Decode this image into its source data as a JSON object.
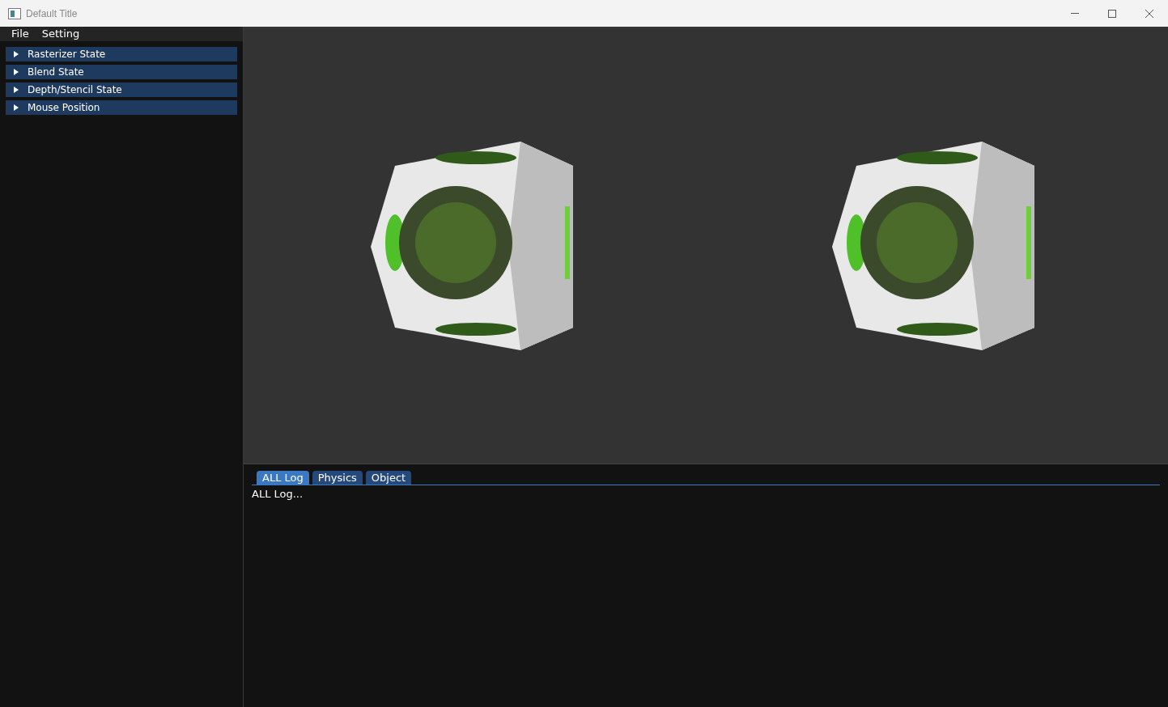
{
  "window": {
    "title": "Default Title"
  },
  "menu": [
    "File",
    "Setting"
  ],
  "tree": [
    {
      "label": "Rasterizer State",
      "expanded": false
    },
    {
      "label": "Blend State",
      "expanded": false
    },
    {
      "label": "Depth/Stencil State",
      "expanded": false
    },
    {
      "label": "Mouse Position",
      "expanded": false
    }
  ],
  "log": {
    "tabs": [
      {
        "label": "ALL Log",
        "selected": true
      },
      {
        "label": "Physics",
        "selected": false
      },
      {
        "label": "Object",
        "selected": false
      }
    ],
    "text": "ALL Log..."
  }
}
